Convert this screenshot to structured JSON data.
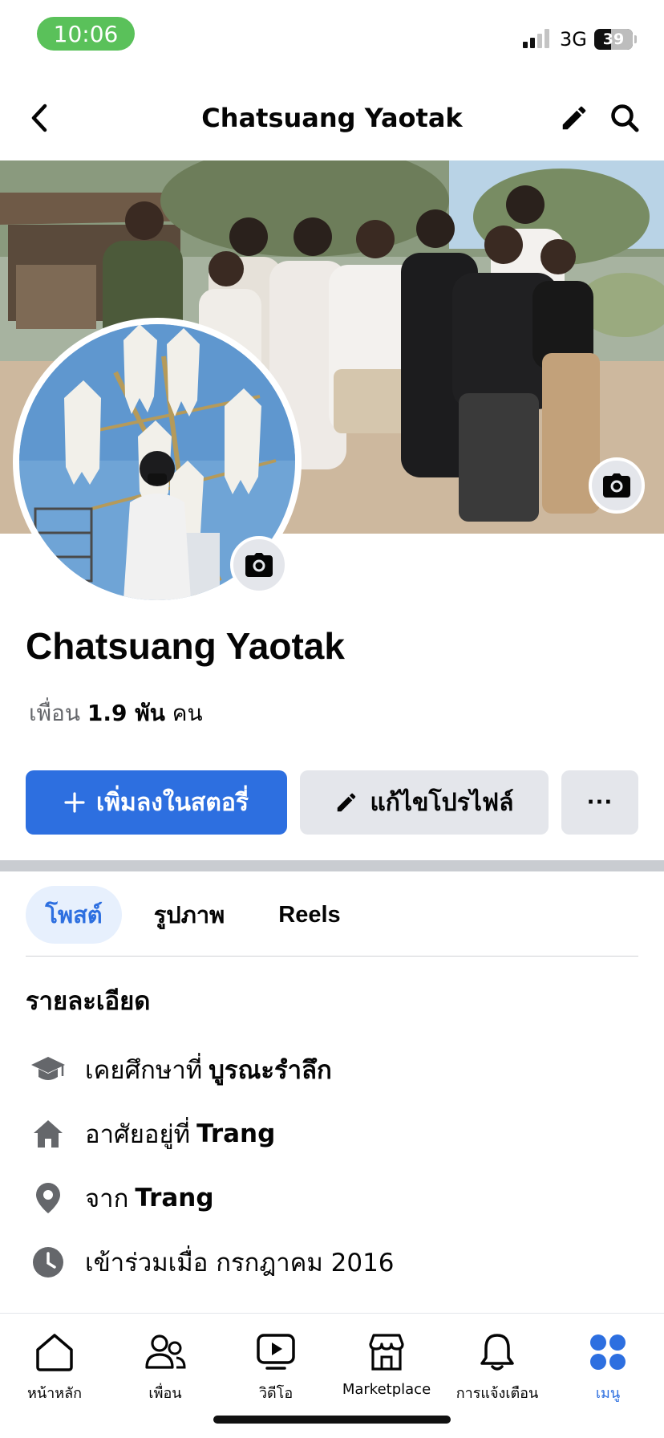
{
  "status_bar": {
    "time": "10:06",
    "network": "3G",
    "battery": "39",
    "signal_bars": 2
  },
  "header": {
    "title": "Chatsuang Yaotak",
    "back_icon": "chevron-left-icon",
    "edit_icon": "pencil-icon",
    "search_icon": "search-icon"
  },
  "profile": {
    "name": "Chatsuang Yaotak",
    "friends_label": "เพื่อน",
    "friends_count": "1.9 พัน",
    "friends_unit": "คน"
  },
  "actions": {
    "add_story": "เพิ่มลงในสตอรี่",
    "edit_profile": "แก้ไขโปรไฟล์",
    "more": "···"
  },
  "tabs": [
    {
      "label": "โพสต์",
      "active": true
    },
    {
      "label": "รูปภาพ",
      "active": false
    },
    {
      "label": "Reels",
      "active": false
    }
  ],
  "details": {
    "heading": "รายละเอียด",
    "items": [
      {
        "icon": "graduation-cap-icon",
        "prefix": "เคยศึกษาที่",
        "value": "บูรณะรำลึก"
      },
      {
        "icon": "home-icon",
        "prefix": "อาศัยอยู่ที่",
        "value": "Trang"
      },
      {
        "icon": "location-pin-icon",
        "prefix": "จาก",
        "value": "Trang"
      },
      {
        "icon": "clock-icon",
        "prefix": "เข้าร่วมเมื่อ กรกฎาคม  2016",
        "value": ""
      }
    ]
  },
  "bottom_nav": [
    {
      "label": "หน้าหลัก",
      "icon": "home-icon",
      "active": false
    },
    {
      "label": "เพื่อน",
      "icon": "friends-icon",
      "active": false
    },
    {
      "label": "วิดีโอ",
      "icon": "video-icon",
      "active": false
    },
    {
      "label": "Marketplace",
      "icon": "marketplace-icon",
      "active": false
    },
    {
      "label": "การแจ้งเตือน",
      "icon": "bell-icon",
      "active": false
    },
    {
      "label": "เมนู",
      "icon": "menu-grid-icon",
      "active": true
    }
  ],
  "colors": {
    "accent": "#2d6fe0",
    "status_pill": "#5ac15a",
    "secondary_button": "#e4e6eb",
    "muted_text": "#65676b"
  }
}
